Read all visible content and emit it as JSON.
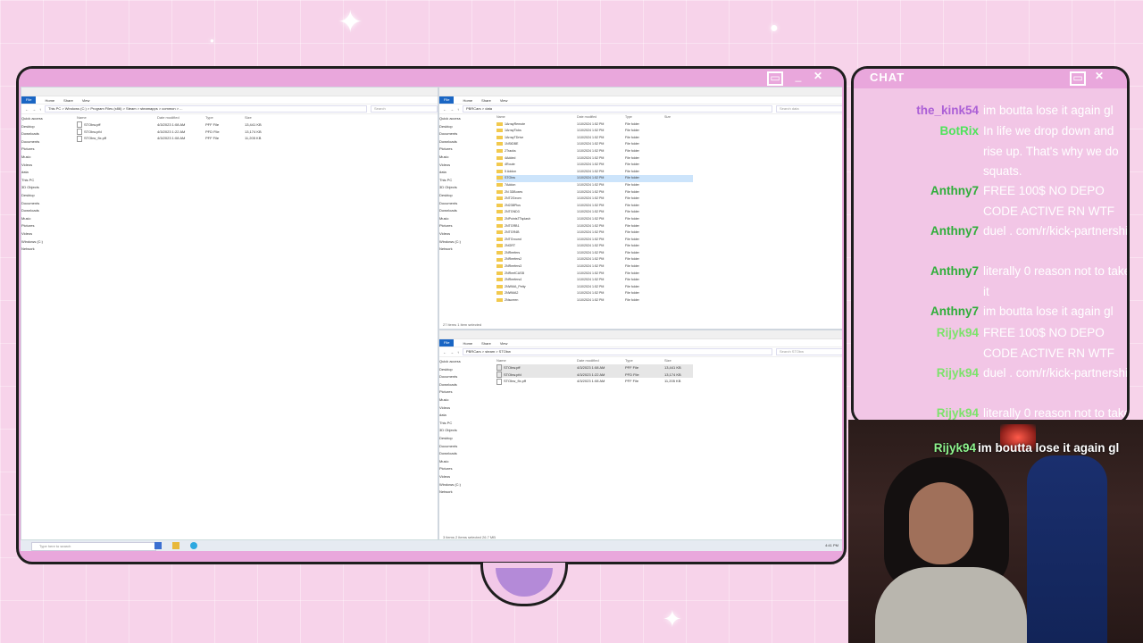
{
  "chat": {
    "title": "CHAT",
    "messages": [
      {
        "user": "the_kink54",
        "user_color": "#ab5fd6",
        "text": "im boutta lose it again gl"
      },
      {
        "user": "BotRix",
        "user_color": "#4fe35b",
        "text": "In life we drop down and rise up. That's why we do squats."
      },
      {
        "user": "Anthny7",
        "user_color": "#2fae3a",
        "text": "FREE 100$ NO DEPO CODE ACTIVE RN WTF"
      },
      {
        "user": "Anthny7",
        "user_color": "#2fae3a",
        "text": "duel . com/r/kick-partnership"
      },
      {
        "user": "Anthny7",
        "user_color": "#2fae3a",
        "text": "literally 0 reason not to take it"
      },
      {
        "user": "Anthny7",
        "user_color": "#2fae3a",
        "text": "im boutta lose it again gl"
      },
      {
        "user": "Rijyk94",
        "user_color": "#7ce36b",
        "text": "FREE 100$ NO DEPO CODE ACTIVE RN WTF"
      },
      {
        "user": "Rijyk94",
        "user_color": "#7ce36b",
        "text": "duel . com/r/kick-partnership"
      },
      {
        "user": "Rijyk94",
        "user_color": "#7ce36b",
        "text": "literally 0 reason not to take it"
      }
    ],
    "cam_message": {
      "user": "Rijyk94",
      "text": "im boutta lose it again gl"
    }
  },
  "taskbar": {
    "search_placeholder": "Type here to search",
    "clock": "4:41 PM"
  },
  "explorer_left": {
    "ribbon": [
      "File",
      "Home",
      "Share",
      "View"
    ],
    "path": "This PC > Windows (C:) > Program Files (x86) > Steam > steamapps > common > ...",
    "search": "Search",
    "nav": [
      "Quick access",
      "Desktop",
      "Downloads",
      "Documents",
      "Pictures",
      "Music",
      "Videos",
      "data",
      "This PC",
      "3D Objects",
      "Desktop",
      "Documents",
      "Downloads",
      "Music",
      "Pictures",
      "Videos",
      "Windows (C:)",
      "Network"
    ],
    "columns": [
      "Name",
      "Date modified",
      "Type",
      "Size"
    ],
    "files": [
      {
        "name": "STObw.pff",
        "date": "4/3/2023 1:08 AM",
        "type": "PFF File",
        "size": "13,441 KB"
      },
      {
        "name": "STObw.pfd",
        "date": "4/3/2023 1:22 AM",
        "type": "PFD File",
        "size": "13,174 KB"
      },
      {
        "name": "STObw_fix.pff",
        "date": "4/3/2023 1:08 AM",
        "type": "PFF File",
        "size": "11,205 KB"
      }
    ]
  },
  "explorer_right_top": {
    "ribbon": [
      "File",
      "Home",
      "Share",
      "View"
    ],
    "path": "PBRCars > data",
    "search": "Search data",
    "nav": [
      "Quick access",
      "Desktop",
      "Documents",
      "Downloads",
      "Pictures",
      "Music",
      "Videos",
      "data",
      "This PC",
      "3D Objects",
      "Desktop",
      "Documents",
      "Downloads",
      "Music",
      "Pictures",
      "Videos",
      "Windows (C:)",
      "Network"
    ],
    "columns": [
      "Name",
      "Date modified",
      "Type",
      "Size"
    ],
    "folders": [
      "1ArrayRemote",
      "1ArrayTicks",
      "1ArrayTDrive",
      "1NStDBE",
      "2Tracks",
      "4Added",
      "4Route",
      "5 Addon",
      "STObw",
      "7Addon",
      "2N 3DBoxes",
      "2NT2Geom",
      "2N23BPlus",
      "2NTGND3",
      "2NPointsTTsplash",
      "2NTGRB1",
      "2NTGR4B",
      "2NTGround",
      "2NGRT",
      "2NReefers",
      "2NReefers2",
      "2NReefers3",
      "2NReefCASB",
      "2NReefers4",
      "2NWMA_Petty",
      "2NWMA2",
      "2Nscreen"
    ],
    "folder_date": "1/10/2024 1:52 PM",
    "folder_type": "File folder",
    "selected_index": 8,
    "status": "27 items   1 item selected"
  },
  "explorer_right_bottom": {
    "ribbon": [
      "File",
      "Home",
      "Share",
      "View"
    ],
    "path": "PBRCars > steam > STObw",
    "search": "Search STObw",
    "nav": [
      "Quick access",
      "Desktop",
      "Documents",
      "Downloads",
      "Pictures",
      "Music",
      "Videos",
      "data",
      "This PC",
      "3D Objects",
      "Desktop",
      "Documents",
      "Downloads",
      "Music",
      "Pictures",
      "Videos",
      "Windows (C:)",
      "Network"
    ],
    "columns": [
      "Name",
      "Date modified",
      "Type",
      "Size"
    ],
    "files": [
      {
        "name": "STObw.pff",
        "date": "4/3/2023 1:08 AM",
        "type": "PFF File",
        "size": "13,441 KB"
      },
      {
        "name": "STObw.pfd",
        "date": "4/3/2023 1:22 AM",
        "type": "PFD File",
        "size": "13,174 KB"
      },
      {
        "name": "STObw_fix.pff",
        "date": "4/3/2023 1:08 AM",
        "type": "PFF File",
        "size": "11,205 KB"
      }
    ],
    "status": "3 items   2 items selected  26.7 MB"
  }
}
